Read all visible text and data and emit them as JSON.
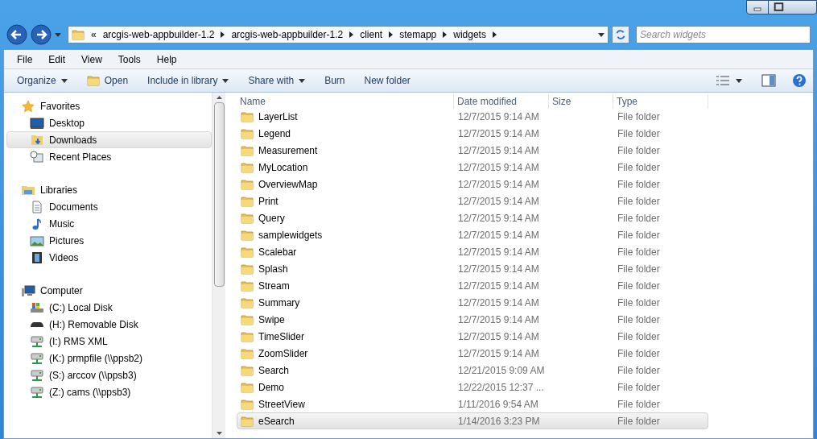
{
  "address": {
    "overflow": "«",
    "crumbs": [
      "arcgis-web-appbuilder-1.2",
      "arcgis-web-appbuilder-1.2",
      "client",
      "stemapp",
      "widgets"
    ]
  },
  "search": {
    "placeholder": "Search widgets"
  },
  "menu": [
    "File",
    "Edit",
    "View",
    "Tools",
    "Help"
  ],
  "commands": [
    {
      "label": "Organize",
      "kind": "dropdown"
    },
    {
      "label": "Open",
      "kind": "open"
    },
    {
      "label": "Include in library",
      "kind": "dropdown"
    },
    {
      "label": "Share with",
      "kind": "dropdown"
    },
    {
      "label": "Burn",
      "kind": "plain"
    },
    {
      "label": "New folder",
      "kind": "plain"
    }
  ],
  "nav": [
    {
      "label": "Favorites",
      "kind": "star",
      "children": [
        {
          "label": "Desktop",
          "kind": "desktop",
          "selected": false
        },
        {
          "label": "Downloads",
          "kind": "downloads",
          "selected": true
        },
        {
          "label": "Recent Places",
          "kind": "recent",
          "selected": false
        }
      ]
    },
    {
      "label": "Libraries",
      "kind": "library",
      "children": [
        {
          "label": "Documents",
          "kind": "document",
          "selected": false
        },
        {
          "label": "Music",
          "kind": "music",
          "selected": false
        },
        {
          "label": "Pictures",
          "kind": "pictures",
          "selected": false
        },
        {
          "label": "Videos",
          "kind": "videos",
          "selected": false
        }
      ]
    },
    {
      "label": "Computer",
      "kind": "computer",
      "children": [
        {
          "label": "(C:) Local Disk",
          "kind": "disk",
          "selected": false
        },
        {
          "label": "(H:) Removable Disk",
          "kind": "removable",
          "selected": false
        },
        {
          "label": "(I:) RMS XML",
          "kind": "network",
          "selected": false
        },
        {
          "label": "(K:) prmpfile (\\\\ppsb2)",
          "kind": "network",
          "selected": false
        },
        {
          "label": "(S:) arccov (\\\\ppsb3)",
          "kind": "network",
          "selected": false
        },
        {
          "label": "(Z:) cams (\\\\ppsb3)",
          "kind": "network",
          "selected": false
        }
      ]
    }
  ],
  "table": {
    "columns": [
      "Name",
      "Date modified",
      "Size",
      "Type"
    ],
    "rows": [
      {
        "name": "LayerList",
        "date": "12/7/2015 9:14 AM",
        "type": "File folder",
        "selected": false
      },
      {
        "name": "Legend",
        "date": "12/7/2015 9:14 AM",
        "type": "File folder",
        "selected": false
      },
      {
        "name": "Measurement",
        "date": "12/7/2015 9:14 AM",
        "type": "File folder",
        "selected": false
      },
      {
        "name": "MyLocation",
        "date": "12/7/2015 9:14 AM",
        "type": "File folder",
        "selected": false
      },
      {
        "name": "OverviewMap",
        "date": "12/7/2015 9:14 AM",
        "type": "File folder",
        "selected": false
      },
      {
        "name": "Print",
        "date": "12/7/2015 9:14 AM",
        "type": "File folder",
        "selected": false
      },
      {
        "name": "Query",
        "date": "12/7/2015 9:14 AM",
        "type": "File folder",
        "selected": false
      },
      {
        "name": "samplewidgets",
        "date": "12/7/2015 9:14 AM",
        "type": "File folder",
        "selected": false
      },
      {
        "name": "Scalebar",
        "date": "12/7/2015 9:14 AM",
        "type": "File folder",
        "selected": false
      },
      {
        "name": "Splash",
        "date": "12/7/2015 9:14 AM",
        "type": "File folder",
        "selected": false
      },
      {
        "name": "Stream",
        "date": "12/7/2015 9:14 AM",
        "type": "File folder",
        "selected": false
      },
      {
        "name": "Summary",
        "date": "12/7/2015 9:14 AM",
        "type": "File folder",
        "selected": false
      },
      {
        "name": "Swipe",
        "date": "12/7/2015 9:14 AM",
        "type": "File folder",
        "selected": false
      },
      {
        "name": "TimeSlider",
        "date": "12/7/2015 9:14 AM",
        "type": "File folder",
        "selected": false
      },
      {
        "name": "ZoomSlider",
        "date": "12/7/2015 9:14 AM",
        "type": "File folder",
        "selected": false
      },
      {
        "name": "Search",
        "date": "12/21/2015 9:09 AM",
        "type": "File folder",
        "selected": false
      },
      {
        "name": "Demo",
        "date": "12/22/2015 12:37 ...",
        "type": "File folder",
        "selected": false
      },
      {
        "name": "StreetView",
        "date": "1/11/2016 9:54 AM",
        "type": "File folder",
        "selected": false
      },
      {
        "name": "eSearch",
        "date": "1/14/2016 3:23 PM",
        "type": "File folder",
        "selected": true
      }
    ]
  }
}
